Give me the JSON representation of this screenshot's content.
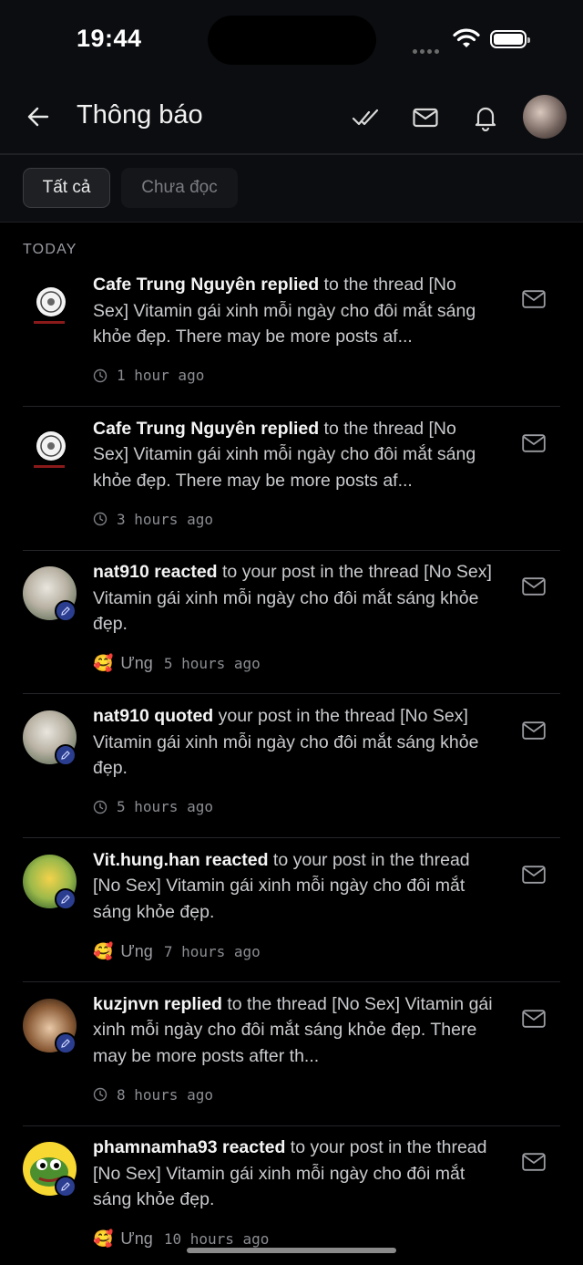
{
  "status_bar": {
    "time": "19:44"
  },
  "header": {
    "title": "Thông báo"
  },
  "tabs": [
    {
      "label": "Tất cả",
      "active": true
    },
    {
      "label": "Chưa đọc",
      "active": false
    }
  ],
  "section": {
    "label": "TODAY"
  },
  "notifications": [
    {
      "user": "Cafe Trung Nguyên",
      "action": "replied",
      "rest": " to the thread [No Sex] Vitamin gái xinh mỗi ngày cho đôi mắt sáng khỏe đẹp. There may be more posts af...",
      "time": "1 hour ago",
      "avatar_icon": "cafe-logo",
      "reaction": ""
    },
    {
      "user": "Cafe Trung Nguyên",
      "action": "replied",
      "rest": " to the thread [No Sex] Vitamin gái xinh mỗi ngày cho đôi mắt sáng khỏe đẹp. There may be more posts af...",
      "time": "3 hours ago",
      "avatar_icon": "cafe-logo",
      "reaction": ""
    },
    {
      "user": "nat910",
      "action": "reacted",
      "rest": " to your post in the thread [No Sex] Vitamin gái xinh mỗi ngày cho đôi mắt sáng khỏe đẹp.",
      "time": "5 hours ago",
      "avatar_icon": "cat-avatar",
      "reaction": "Ưng",
      "reaction_emoji": "🥰"
    },
    {
      "user": "nat910",
      "action": "quoted",
      "rest": " your post in the thread [No Sex] Vitamin gái xinh mỗi ngày cho đôi mắt sáng khỏe đẹp.",
      "time": "5 hours ago",
      "avatar_icon": "cat-avatar",
      "reaction": ""
    },
    {
      "user": "Vit.hung.han",
      "action": "reacted",
      "rest": " to your post in the thread [No Sex] Vitamin gái xinh mỗi ngày cho đôi mắt sáng khỏe đẹp.",
      "time": "7 hours ago",
      "avatar_icon": "duck-avatar",
      "reaction": "Ưng",
      "reaction_emoji": "🥰"
    },
    {
      "user": "kuzjnvn",
      "action": "replied",
      "rest": " to the thread [No Sex] Vitamin gái xinh mỗi ngày cho đôi mắt sáng khỏe đẹp. There may be more posts after th...",
      "time": "8 hours ago",
      "avatar_icon": "girl-avatar",
      "reaction": ""
    },
    {
      "user": "phamnamha93",
      "action": "reacted",
      "rest": " to your post in the thread [No Sex] Vitamin gái xinh mỗi ngày cho đôi mắt sáng khỏe đẹp.",
      "time": "10 hours ago",
      "avatar_icon": "pepe-avatar",
      "reaction": "Ưng",
      "reaction_emoji": "🥰"
    }
  ]
}
